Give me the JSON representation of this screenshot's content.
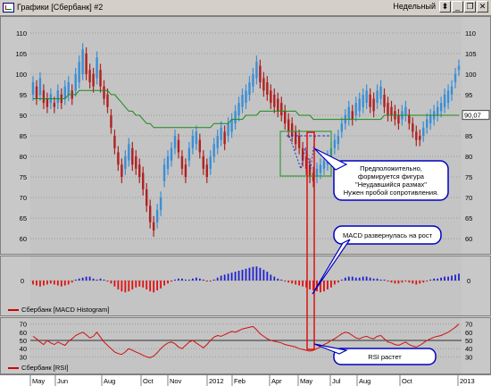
{
  "window": {
    "title": "Графики [Сбербанк] #2",
    "period": "Недельный",
    "buttons": [
      "period-dropdown-icon",
      "minimize-icon",
      "restore-icon",
      "close-icon"
    ]
  },
  "colors": {
    "up": "#3a8fd6",
    "down": "#b02020",
    "ma": "#1a8a1a",
    "macd_pos": "#2020d0",
    "macd_neg": "#e01010",
    "rsi": "#d01010",
    "callout_border": "#0000c0",
    "box": "#3a9a3a",
    "highlight": "#e01010"
  },
  "price_panel": {
    "y_ticks": [
      "110",
      "105",
      "100",
      "95",
      "90",
      "85",
      "80",
      "75",
      "70",
      "65",
      "60"
    ],
    "right_ticks": [
      "110",
      "105",
      "100",
      "95",
      "90",
      "85",
      "80",
      "75",
      "70",
      "65",
      "60"
    ],
    "last_price": "90,07",
    "annotation": [
      "Предположительно,",
      "формируется фигура",
      "\"Неудавшийся размах\"",
      "Нужен пробой сопротивления."
    ]
  },
  "macd_panel": {
    "y_tick": "0",
    "legend": "Сбербанк [MACD Histogram]",
    "annotation": "MACD развернулась на рост"
  },
  "rsi_panel": {
    "left_ticks": [
      "70",
      "60",
      "50",
      "40",
      "30"
    ],
    "right_ticks": [
      "70",
      "60",
      "50",
      "40",
      "30"
    ],
    "legend": "Сбербанк [RSI]",
    "annotation": "RSI растет"
  },
  "time_axis": [
    "May",
    "Jun",
    "Aug",
    "Oct",
    "Nov",
    "2012",
    "Feb",
    "Apr",
    "May",
    "Jul",
    "Aug",
    "Oct",
    "2013"
  ],
  "chart_data": [
    {
      "type": "candlestick",
      "title": "",
      "ylim": [
        57,
        113
      ],
      "series": [
        {
          "name": "",
          "values": [
            98,
            97,
            99,
            96,
            94,
            95,
            93,
            96,
            95,
            97,
            98,
            96,
            100,
            103,
            106,
            105,
            101,
            100,
            104,
            101,
            97,
            95,
            90,
            85,
            81,
            78,
            80,
            83,
            82,
            80,
            78,
            76,
            72,
            68,
            64,
            67,
            70,
            78,
            80,
            82,
            85,
            84,
            80,
            78,
            82,
            85,
            86,
            84,
            80,
            78,
            80,
            83,
            85,
            87,
            86,
            88,
            89,
            91,
            93,
            95,
            96,
            98,
            100,
            103,
            102,
            99,
            98,
            96,
            95,
            94,
            93,
            91,
            89,
            88,
            86,
            85,
            82,
            80,
            78,
            76,
            77,
            78,
            79,
            80,
            82,
            84,
            85,
            88,
            90,
            92,
            91,
            93,
            94,
            95,
            96,
            95,
            94,
            96,
            97,
            95,
            93,
            92,
            91,
            90,
            91,
            92,
            90,
            88,
            86,
            85,
            87,
            89,
            90,
            91,
            92,
            93,
            95,
            96,
            97,
            100,
            102
          ]
        },
        {
          "name": "",
          "values": [
            95,
            94,
            95,
            93,
            92,
            93,
            92,
            93,
            93,
            94,
            95,
            94,
            96,
            98,
            100,
            100,
            98,
            97,
            99,
            97,
            94,
            92,
            87,
            82,
            78,
            75,
            77,
            79,
            78,
            77,
            75,
            72,
            68,
            64,
            62,
            64,
            67,
            74,
            77,
            79,
            82,
            81,
            77,
            75,
            79,
            82,
            83,
            81,
            77,
            75,
            77,
            80,
            82,
            84,
            83,
            85,
            86,
            88,
            90,
            92,
            93,
            95,
            97,
            99,
            98,
            96,
            95,
            93,
            92,
            91,
            90,
            88,
            86,
            85,
            83,
            82,
            79,
            77,
            75,
            74,
            75,
            76,
            77,
            78,
            80,
            82,
            83,
            86,
            88,
            89,
            89,
            90,
            91,
            92,
            93,
            92,
            91,
            93,
            94,
            92,
            90,
            90,
            89,
            88,
            89,
            90,
            88,
            86,
            84,
            84,
            85,
            87,
            88,
            89,
            90,
            91,
            92,
            93,
            95,
            98,
            101
          ]
        }
      ],
      "moving_average": [
        94,
        94,
        94,
        94,
        94,
        94,
        94,
        94,
        94,
        94,
        95,
        95,
        95,
        96,
        96,
        96,
        96,
        96,
        96,
        96,
        96,
        96,
        95,
        95,
        94,
        93,
        92,
        91,
        91,
        90,
        90,
        89,
        88,
        88,
        87,
        87,
        87,
        87,
        87,
        87,
        87,
        87,
        87,
        87,
        87,
        87,
        87,
        87,
        87,
        87,
        87,
        88,
        88,
        88,
        88,
        88,
        89,
        89,
        89,
        89,
        90,
        90,
        90,
        90,
        91,
        91,
        91,
        91,
        91,
        91,
        91,
        91,
        91,
        91,
        91,
        90,
        90,
        90,
        90,
        89,
        89,
        89,
        89,
        89,
        89,
        89,
        89,
        89,
        89,
        89,
        89,
        89,
        89,
        89,
        89,
        89,
        89,
        89,
        89,
        90,
        90,
        90,
        90,
        90,
        90,
        90,
        90,
        90,
        90,
        90,
        90,
        90,
        90,
        90,
        90,
        90,
        90,
        90,
        90,
        90,
        90
      ],
      "last": 90.07
    },
    {
      "type": "bar",
      "title": "Сбербанк [MACD Histogram]",
      "ylim": [
        -1,
        1
      ],
      "values": [
        -0.2,
        -0.25,
        -0.3,
        -0.25,
        -0.2,
        -0.15,
        -0.2,
        -0.25,
        -0.3,
        -0.25,
        -0.2,
        -0.1,
        0.05,
        0.1,
        0.15,
        0.2,
        0.2,
        0.1,
        0.05,
        0.1,
        0.05,
        -0.05,
        -0.15,
        -0.3,
        -0.45,
        -0.55,
        -0.6,
        -0.55,
        -0.45,
        -0.35,
        -0.3,
        -0.35,
        -0.45,
        -0.55,
        -0.6,
        -0.5,
        -0.4,
        -0.25,
        -0.15,
        -0.05,
        0.05,
        0.1,
        0.1,
        0.05,
        0.05,
        0.1,
        0.15,
        0.1,
        0.05,
        -0.05,
        -0.05,
        0.05,
        0.15,
        0.25,
        0.3,
        0.35,
        0.4,
        0.45,
        0.5,
        0.55,
        0.6,
        0.65,
        0.7,
        0.72,
        0.65,
        0.55,
        0.45,
        0.3,
        0.2,
        0.1,
        0.05,
        -0.05,
        -0.1,
        -0.15,
        -0.2,
        -0.25,
        -0.3,
        -0.35,
        -0.45,
        -0.5,
        -0.55,
        -0.6,
        -0.55,
        -0.45,
        -0.35,
        -0.2,
        -0.1,
        0.05,
        0.15,
        0.2,
        0.2,
        0.15,
        0.15,
        0.2,
        0.2,
        0.15,
        0.1,
        0.1,
        0.05,
        0.05,
        -0.05,
        -0.1,
        -0.15,
        -0.15,
        -0.1,
        -0.05,
        -0.1,
        -0.15,
        -0.2,
        -0.15,
        -0.1,
        -0.05,
        0.05,
        0.1,
        0.1,
        0.15,
        0.2,
        0.2,
        0.25,
        0.3,
        0.35
      ]
    },
    {
      "type": "line",
      "title": "Сбербанк [RSI]",
      "ylim": [
        25,
        75
      ],
      "values": [
        55,
        52,
        48,
        45,
        50,
        47,
        45,
        48,
        46,
        44,
        49,
        52,
        56,
        58,
        60,
        57,
        53,
        55,
        60,
        54,
        48,
        44,
        40,
        36,
        34,
        33,
        36,
        40,
        38,
        36,
        34,
        32,
        30,
        29,
        31,
        35,
        40,
        44,
        47,
        48,
        46,
        42,
        40,
        44,
        48,
        50,
        47,
        44,
        41,
        45,
        50,
        54,
        56,
        55,
        57,
        59,
        61,
        60,
        62,
        64,
        65,
        66,
        67,
        63,
        58,
        55,
        52,
        50,
        49,
        48,
        47,
        45,
        44,
        43,
        42,
        40,
        39,
        38,
        37,
        38,
        40,
        42,
        45,
        47,
        50,
        52,
        55,
        58,
        60,
        59,
        56,
        53,
        52,
        54,
        55,
        53,
        52,
        55,
        56,
        52,
        48,
        47,
        45,
        44,
        46,
        48,
        45,
        43,
        42,
        44,
        47,
        50,
        52,
        54,
        55,
        56,
        58,
        60,
        63,
        66,
        70
      ]
    }
  ]
}
